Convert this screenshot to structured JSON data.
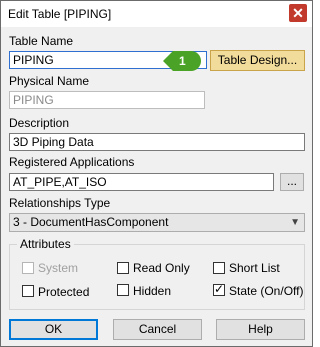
{
  "window": {
    "title": "Edit Table [PIPING]",
    "close_glyph": "✕"
  },
  "table_name": {
    "label": "Table Name",
    "value": "PIPING"
  },
  "table_design_button": {
    "label": "Table Design..."
  },
  "badge": {
    "number": "1",
    "color": "#4aa326"
  },
  "physical_name": {
    "label": "Physical Name",
    "value": "PIPING"
  },
  "description": {
    "label": "Description",
    "value": "3D Piping Data"
  },
  "registered_applications": {
    "label": "Registered Applications",
    "value": "AT_PIPE,AT_ISO",
    "browse_label": "..."
  },
  "relationships_type": {
    "label": "Relationships Type",
    "value": "3 - DocumentHasComponent"
  },
  "attributes": {
    "label": "Attributes",
    "system": {
      "label": "System",
      "checked": false,
      "enabled": false
    },
    "read_only": {
      "label": "Read Only",
      "checked": false,
      "enabled": true
    },
    "short_list": {
      "label": "Short List",
      "checked": false,
      "enabled": true
    },
    "protected": {
      "label": "Protected",
      "checked": false,
      "enabled": true
    },
    "hidden": {
      "label": "Hidden",
      "checked": false,
      "enabled": true
    },
    "state": {
      "label": "State (On/Off)",
      "checked": true,
      "enabled": true
    }
  },
  "buttons": {
    "ok": "OK",
    "cancel": "Cancel",
    "help": "Help"
  }
}
